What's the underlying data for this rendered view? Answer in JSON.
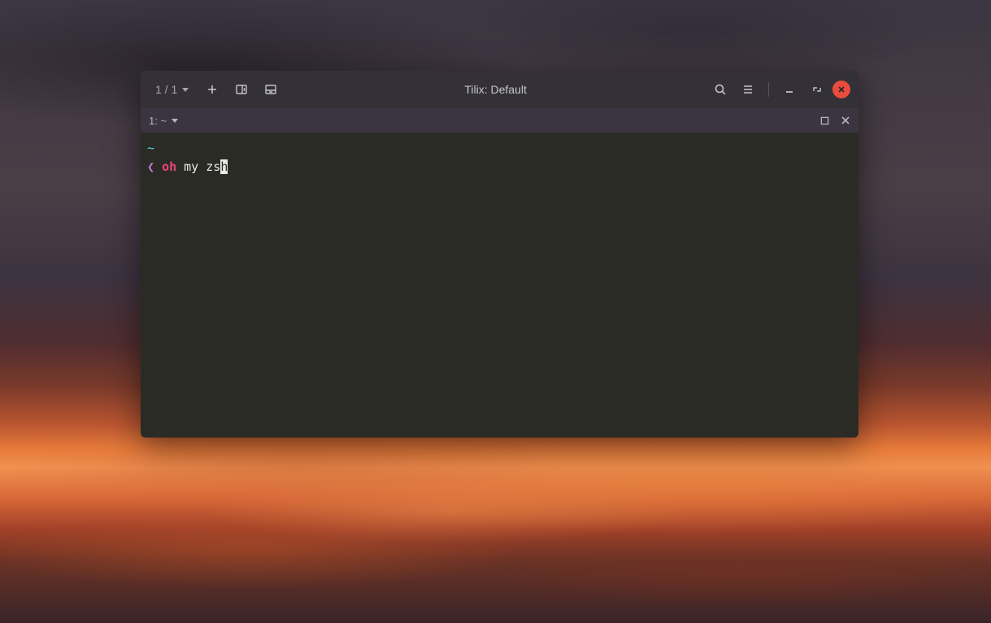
{
  "window": {
    "title": "Tilix: Default"
  },
  "titlebar": {
    "session_indicator": "1 / 1"
  },
  "tabbar": {
    "label": "1: ~"
  },
  "terminal": {
    "cwd": "~",
    "prompt": "❮",
    "command": {
      "first_word": "oh",
      "rest_pre_cursor": "my zs",
      "cursor_char": "h"
    }
  },
  "icons": {
    "add": "+",
    "search": "search",
    "menu": "menu",
    "minimize": "-",
    "maximize": "maximize",
    "close": "close"
  }
}
